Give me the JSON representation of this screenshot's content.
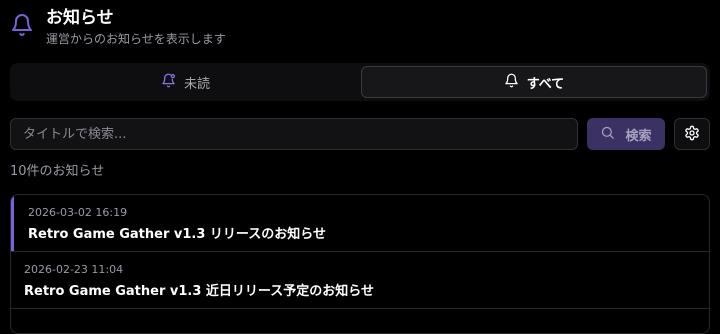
{
  "header": {
    "title": "お知らせ",
    "subtitle": "運営からのお知らせを表示します",
    "icon": "bell-icon",
    "accent_color": "#7b61d9"
  },
  "tabs": [
    {
      "label": "未読",
      "icon": "bell-unread-icon",
      "selected": false
    },
    {
      "label": "すべて",
      "icon": "bell-icon",
      "selected": true
    }
  ],
  "search": {
    "placeholder": "タイトルで検索...",
    "value": "",
    "button_label": "検索",
    "button_icon": "search-icon",
    "settings_icon": "gear-icon"
  },
  "count_text": "10件のお知らせ",
  "notices": [
    {
      "date": "2026-03-02 16:19",
      "title": "Retro Game Gather v1.3 リリースのお知らせ",
      "unread": true
    },
    {
      "date": "2026-02-23 11:04",
      "title": "Retro Game Gather v1.3 近日リリース予定のお知らせ",
      "unread": false
    }
  ]
}
